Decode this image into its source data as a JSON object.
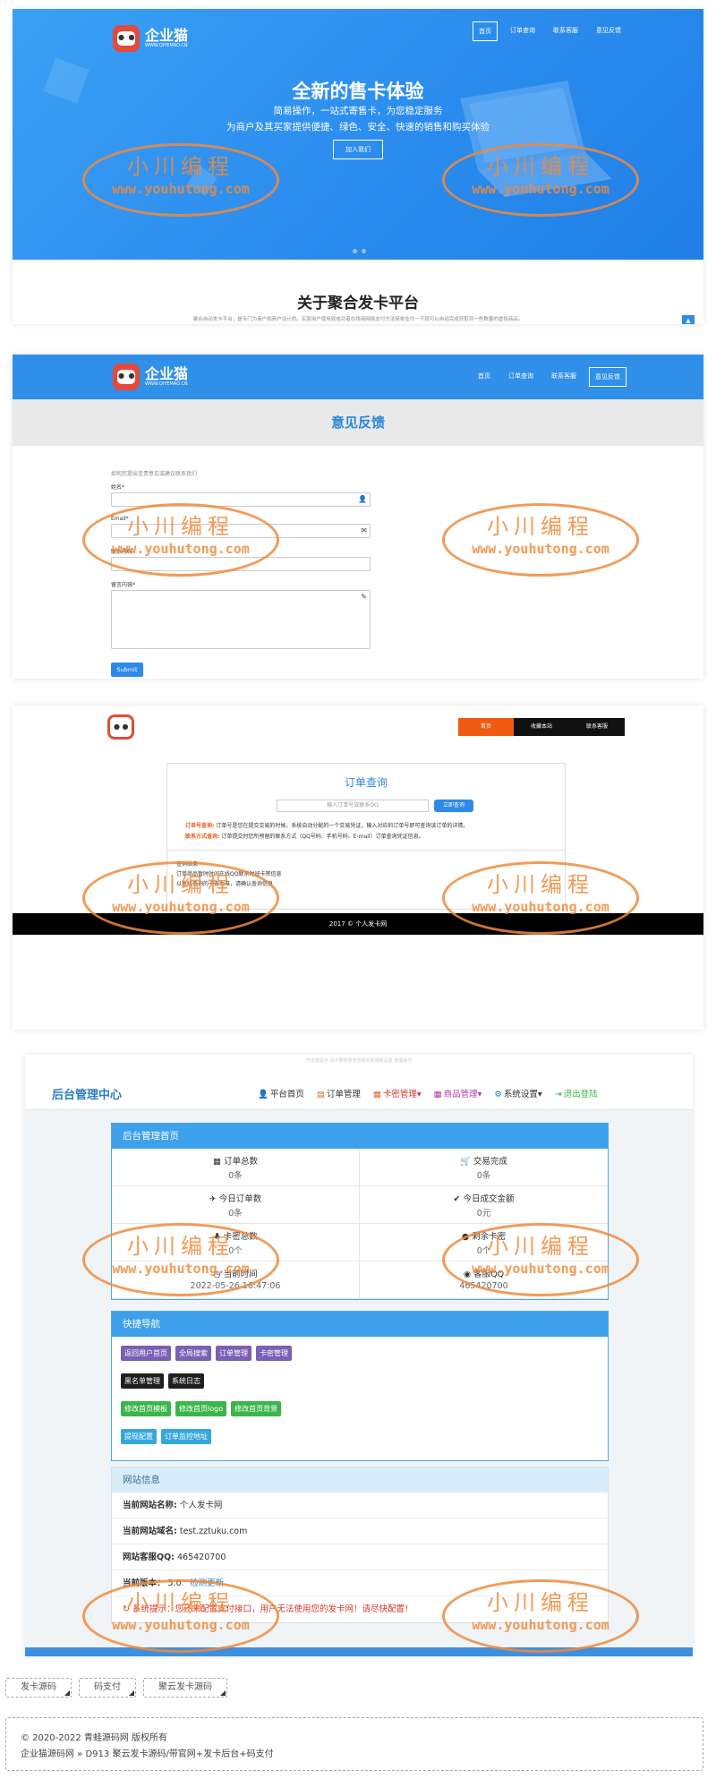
{
  "colors": {
    "primary": "#2d8ae8",
    "orange": "#f05a13",
    "watermark": "#f08a3c",
    "danger": "#d9362a"
  },
  "watermark": {
    "line1": "小川编程",
    "line2": "www.youhutong.com"
  },
  "site1": {
    "logo_text": "企业猫",
    "logo_sub": "WWW.QIYEMAO.CN",
    "nav": [
      "首页",
      "订单查询",
      "联系客服",
      "意见反馈"
    ],
    "hero_title": "全新的售卡体验",
    "hero_sub1": "简易操作，一站式寄售卡，为您稳定服务",
    "hero_sub2": "为商户及其买家提供便捷、绿色、安全、快速的销售和购买体验",
    "join_button": "加入我们",
    "about_title": "关于聚合发卡平台",
    "about_desc": "聚合自动发卡平台，是专门为商户和商户设计的。买家用户使用较成功者在线用网络支付方法简单支付一下就可以自动完成获取到一些数量的虚拟商品。"
  },
  "site2": {
    "title": "意见反馈",
    "hint": "如何您提出宝贵意见或建议联系我们",
    "name_label": "姓名*",
    "email_label": "Email*",
    "phone_label": "联系号码",
    "content_label": "留言内容*",
    "submit": "Submit"
  },
  "site3": {
    "nav": [
      "首页",
      "收藏本站",
      "联系客服"
    ],
    "title": "订单查询",
    "search_placeholder": "输入订单号或联系QQ",
    "search_button": "立即查询",
    "tip1_label": "订单号查询:",
    "tip1": "订单号是您在提交交易的时候，系统自动分配的一个交易凭证，输入对应的订单号即可查询该订单的详情。",
    "tip2_label": "联系方式查询:",
    "tip2": "订单提交时您所预留的联系方式（QQ号码、手机号码、E-mail）订单查询凭证信息。",
    "result_title": "查询结果",
    "result1": "订单商品暂时时间在线QQ联系时间卡密信息",
    "result2": "以系统查询的卡密为准，请确认查询信息",
    "footer": "2017 © 个人发卡网"
  },
  "admin": {
    "topline": "开发者提示 请不要随意修改相关数据和设置 谨慎操作",
    "brand": "后台管理中心",
    "nav": [
      {
        "icon": "👤",
        "label": "平台首页"
      },
      {
        "icon": "▤",
        "label": "订单管理"
      },
      {
        "icon": "▦",
        "label": "卡密管理▾"
      },
      {
        "icon": "▦",
        "label": "商品管理▾"
      },
      {
        "icon": "⚙",
        "label": "系统设置▾"
      },
      {
        "icon": "⇥",
        "label": "退出登陆"
      }
    ],
    "home_title": "后台管理首页",
    "stats": [
      {
        "icon": "▦",
        "label": "订单总数",
        "value": "0条"
      },
      {
        "icon": "🛒",
        "label": "交易完成",
        "value": "0条"
      },
      {
        "icon": "✈",
        "label": "今日订单数",
        "value": "0条"
      },
      {
        "icon": "✔",
        "label": "今日成交金额",
        "value": "0元"
      },
      {
        "icon": "♣",
        "label": "卡密总数",
        "value": "0个"
      },
      {
        "icon": "●",
        "label": "剩余卡密",
        "value": "0个"
      },
      {
        "icon": "◷",
        "label": "当前时间",
        "value": "2022-05-26 16:47:06"
      },
      {
        "icon": "◉",
        "label": "客服QQ",
        "value": "465420700"
      }
    ],
    "quick_title": "快捷导航",
    "quick_rows": [
      [
        "返回用户首页",
        "全局搜索",
        "订单管理",
        "卡密管理"
      ],
      [
        "黑名单管理",
        "系统日志"
      ],
      [
        "修改首页模板",
        "修改首页logo",
        "修改首页背景"
      ],
      [
        "提现配置",
        "订单监控地址"
      ]
    ],
    "info_title": "网站信息",
    "site_name_label": "当前网站名称:",
    "site_name": "个人发卡网",
    "site_domain_label": "当前网站域名:",
    "site_domain": "test.zztuku.com",
    "qq_label": "网站客服QQ:",
    "qq": "465420700",
    "version_label": "当前版本：",
    "version": "5.0",
    "update_link": "检测更新",
    "warning": "系统提示：您还未配置支付接口，用户无法使用您的发卡网！请尽快配置！"
  },
  "tags": [
    "发卡源码",
    "码支付",
    "聚云发卡源码"
  ],
  "footer": {
    "line1": "© 2020-2022 青蛙源码网 版权所有",
    "line2": "企业猫源码网 » D913 聚云发卡源码/带官网+发卡后台+码支付"
  }
}
